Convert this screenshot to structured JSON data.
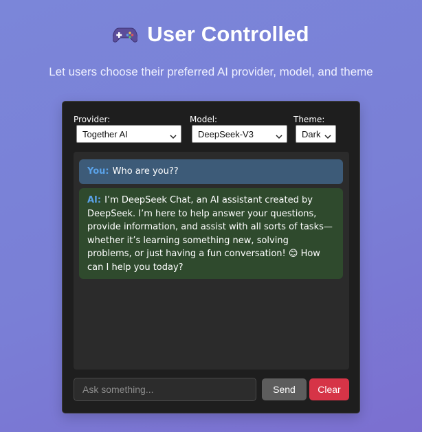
{
  "header": {
    "title": "User Controlled",
    "subtitle": "Let users choose their preferred AI provider, model, and theme"
  },
  "controls": {
    "provider": {
      "label": "Provider:",
      "value": "Together AI"
    },
    "model": {
      "label": "Model:",
      "value": "DeepSeek-V3"
    },
    "theme": {
      "label": "Theme:",
      "value": "Dark"
    }
  },
  "chat": {
    "messages": [
      {
        "sender": "You:",
        "text": "Who are you??"
      },
      {
        "sender": "AI:",
        "text": "I’m DeepSeek Chat, an AI assistant created by DeepSeek. I’m here to help answer your questions, provide information, and assist with all sorts of tasks—whether it’s learning something new, solving problems, or just having a fun conversation! 😊 How can I help you today?"
      }
    ]
  },
  "composer": {
    "placeholder": "Ask something...",
    "send_label": "Send",
    "clear_label": "Clear"
  },
  "colors": {
    "background": "#7b80d7",
    "card": "#1e1e1e",
    "user_bubble": "#3d5b78",
    "ai_bubble": "#2f4a2d",
    "sender_label": "#5aa2e8",
    "send_button": "#5d5d5d",
    "clear_button": "#d63447"
  },
  "icons": {
    "title": "gamepad-icon",
    "select_arrow": "chevron-down-icon"
  }
}
